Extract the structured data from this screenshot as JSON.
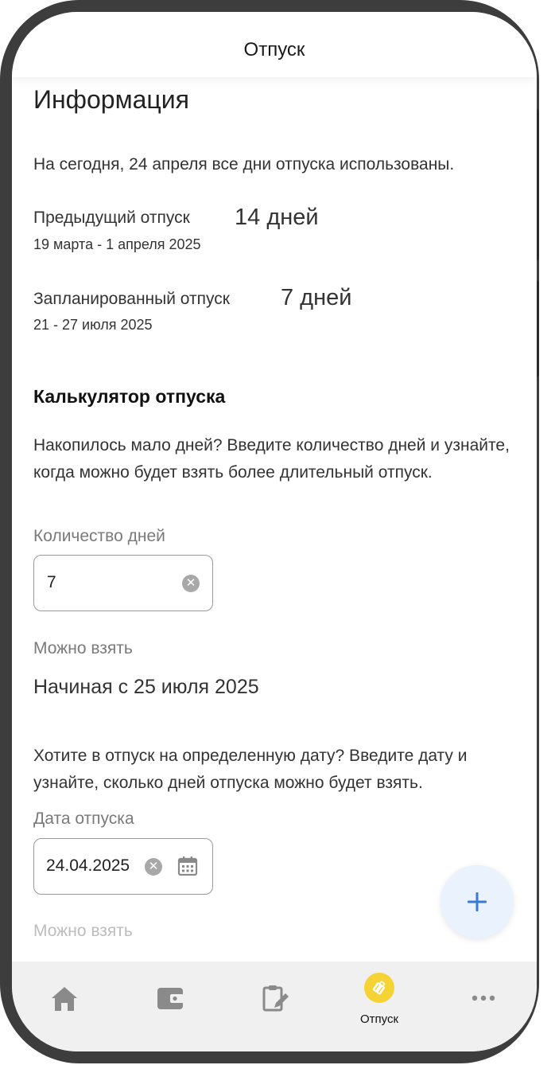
{
  "header": {
    "title": "Отпуск"
  },
  "info": {
    "heading": "Информация",
    "today_text": "На сегодня, 24 апреля все дни отпуска использованы.",
    "previous": {
      "label": "Предыдущий отпуск",
      "days": "14 дней",
      "dates": "19 марта - 1 апреля 2025"
    },
    "planned": {
      "label": "Запланированный отпуск",
      "days": "7 дней",
      "dates": "21 - 27 июля 2025"
    }
  },
  "calculator": {
    "heading": "Калькулятор отпуска",
    "description": "Накопилось мало дней? Введите количество дней и узнайте, когда можно будет взять более длительный отпуск.",
    "days_field": {
      "label": "Количество дней",
      "value": "7"
    },
    "can_take_label": "Можно взять",
    "can_take_result": "Начиная с 25 июля 2025",
    "date_description": "Хотите в отпуск на определенную дату? Введите дату и узнайте, сколько дней отпуска можно будет взять.",
    "date_field": {
      "label": "Дата отпуска",
      "value": "24.04.2025"
    },
    "can_take_label_2": "Можно взять"
  },
  "bottom_nav": {
    "items": [
      {
        "icon": "home-icon"
      },
      {
        "icon": "wallet-icon"
      },
      {
        "icon": "clipboard-edit-icon"
      },
      {
        "icon": "suitcase-icon",
        "label": "Отпуск",
        "active": true
      },
      {
        "icon": "more-icon"
      }
    ]
  },
  "colors": {
    "accent": "#f5d335",
    "fab_bg": "#e9f2fd",
    "fab_icon": "#3a7bd5",
    "nav_icon": "#8a8a8a"
  }
}
